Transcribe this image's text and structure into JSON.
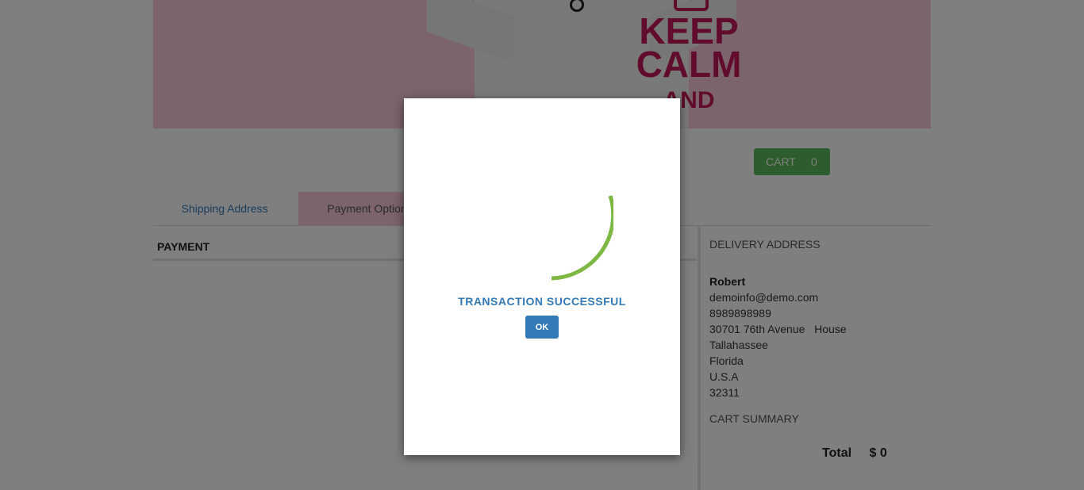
{
  "banner": {
    "shirt_text_line1": "KEEP",
    "shirt_text_line2": "CALM",
    "shirt_text_line3": "AND",
    "background_color": "#f6c9d6",
    "accent_color": "#c2185b"
  },
  "cart": {
    "label": "CART",
    "count": "0",
    "color": "#5cb85c"
  },
  "tabs": [
    {
      "label": "Shipping Address"
    },
    {
      "label": "Payment Options"
    }
  ],
  "payment": {
    "heading": "PAYMENT"
  },
  "delivery": {
    "title": "DELIVERY ADDRESS",
    "name": "Robert",
    "email": "demoinfo@demo.com",
    "phone": "8989898989",
    "street": "30701 76th Avenue   House",
    "city": "Tallahassee",
    "state": "Florida",
    "country": "U.S.A",
    "zip": "32311"
  },
  "cart_summary": {
    "title": "CART SUMMARY",
    "total_label": "Total",
    "total_value": "$ 0"
  },
  "modal": {
    "message": "TRANSACTION SUCCESSFUL",
    "ok_label": "OK",
    "spinner_icon": "loading-spinner-icon",
    "spinner_color": "#7cb842"
  }
}
